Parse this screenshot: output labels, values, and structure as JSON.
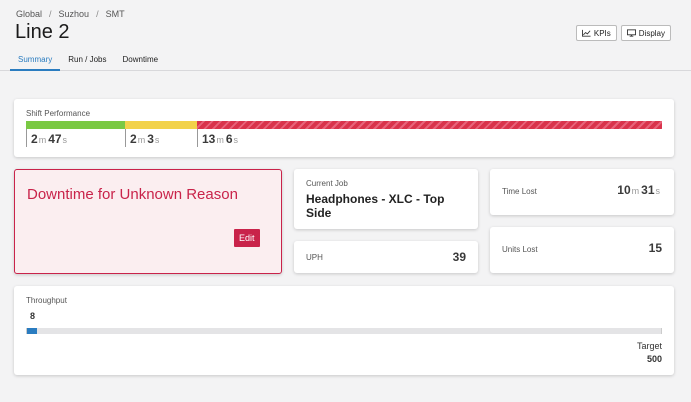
{
  "breadcrumb": [
    "Global",
    "Suzhou",
    "SMT"
  ],
  "page_title": "Line 2",
  "tabs": [
    {
      "label": "Summary",
      "active": true
    },
    {
      "label": "Run / Jobs",
      "active": false
    },
    {
      "label": "Downtime",
      "active": false
    }
  ],
  "header_buttons": {
    "kpis": "KPIs",
    "display": "Display"
  },
  "icons": {
    "kpis": "line-chart-icon",
    "display": "monitor-icon"
  },
  "colors": {
    "accent": "#2a7cc0",
    "good": "#7ac943",
    "warn": "#f2d24a",
    "down": "#c9234a"
  },
  "shift_performance": {
    "label": "Shift Performance",
    "segments": [
      {
        "state": "running",
        "m": "2",
        "s": "47",
        "m_unit": "m",
        "s_unit": "s"
      },
      {
        "state": "warning",
        "m": "2",
        "s": "3",
        "m_unit": "m",
        "s_unit": "s"
      },
      {
        "state": "down",
        "m": "13",
        "s": "6",
        "m_unit": "m",
        "s_unit": "s"
      }
    ]
  },
  "downtime": {
    "title": "Downtime for Unknown Reason",
    "edit_label": "Edit"
  },
  "current_job": {
    "label": "Current Job",
    "name": "Headphones - XLC - Top Side"
  },
  "uph": {
    "label": "UPH",
    "value": "39"
  },
  "time_lost": {
    "label": "Time Lost",
    "m": "10",
    "s": "31",
    "m_unit": "m",
    "s_unit": "s"
  },
  "units_lost": {
    "label": "Units Lost",
    "value": "15"
  },
  "throughput": {
    "label": "Throughput",
    "value": "8",
    "target_label": "Target",
    "target_value": "500",
    "progress": 0.016
  }
}
